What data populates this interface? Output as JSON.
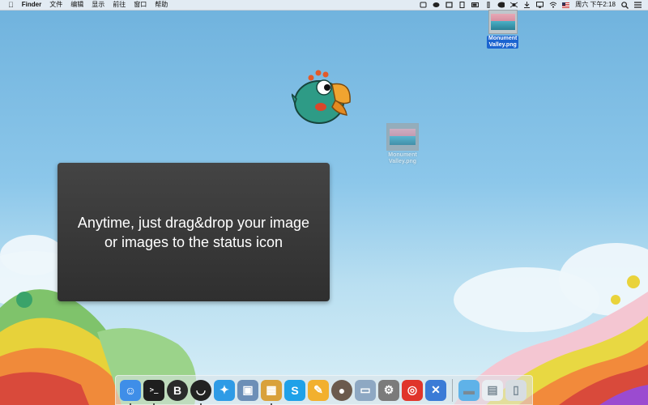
{
  "menubar": {
    "apple_icon": "apple-logo",
    "app_name": "Finder",
    "menus": [
      "文件",
      "编辑",
      "显示",
      "前往",
      "窗口",
      "帮助"
    ],
    "tray_icons": [
      "upload-status-icon",
      "eye-icon",
      "window-icon",
      "clipboard-icon",
      "battery-icon",
      "pencil-icon",
      "cloud-icon",
      "spider-icon",
      "download-icon",
      "monitor-icon",
      "wifi-icon",
      "us-flag-icon"
    ],
    "clock": "周六 下午2:18",
    "search_icon": "search-icon",
    "list_icon": "list-icon"
  },
  "overlay": {
    "line1": "Anytime, just drag&drop your image",
    "line2": "or images to the status icon"
  },
  "desktop_icons": [
    {
      "name": "Monument",
      "name2": "Valley.png",
      "state": "selected"
    },
    {
      "name": "Monument",
      "name2": "Valley.png",
      "state": "dragging"
    }
  ],
  "dock": {
    "apps": [
      {
        "name": "finder-icon",
        "color": "#3f8ee8",
        "running": true
      },
      {
        "name": "terminal-icon",
        "color": "#1e1e1e",
        "running": true
      },
      {
        "name": "bbedit-icon",
        "color": "#2b2b2b",
        "running": false
      },
      {
        "name": "mustache-icon",
        "color": "#222222",
        "running": true
      },
      {
        "name": "safari-icon",
        "color": "#2e9be6",
        "running": false
      },
      {
        "name": "preview-icon",
        "color": "#6c8fb7",
        "running": false
      },
      {
        "name": "photo-booth-icon",
        "color": "#d9a13b",
        "running": true
      },
      {
        "name": "skype-icon",
        "color": "#1fa1e8",
        "running": false
      },
      {
        "name": "pages-icon",
        "color": "#f2b02e",
        "running": false
      },
      {
        "name": "compressor-icon",
        "color": "#6b5a4d",
        "running": false
      },
      {
        "name": "image-capture-icon",
        "color": "#8ea8c3",
        "running": false
      },
      {
        "name": "system-preferences-icon",
        "color": "#7b7b7b",
        "running": false
      },
      {
        "name": "netease-music-icon",
        "color": "#e0352b",
        "running": false
      },
      {
        "name": "xcode-icon",
        "color": "#3b7bd6",
        "running": false
      }
    ],
    "stacks": [
      {
        "name": "folder-icon",
        "color": "#5fb2e8"
      },
      {
        "name": "documents-icon",
        "color": "#e9eef2"
      },
      {
        "name": "trash-icon",
        "color": "#d7dde1"
      }
    ]
  }
}
